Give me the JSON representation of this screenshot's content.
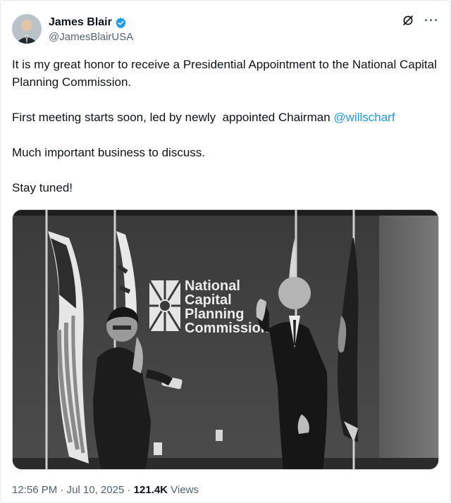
{
  "author": {
    "display_name": "James Blair",
    "handle": "@JamesBlairUSA",
    "verified": true
  },
  "icons": {
    "verified": "verified-badge-icon",
    "grok": "grok-icon",
    "more": "more-options-icon"
  },
  "tweet": {
    "paragraph_1": "It is my great honor to receive a Presidential Appointment to the National Capital Planning Commission.",
    "paragraph_2_text": "First meeting starts soon, led by newly  appointed Chairman ",
    "paragraph_2_mention": "@willscharf",
    "paragraph_3": "Much important business to discuss.",
    "paragraph_4": "Stay tuned!"
  },
  "media": {
    "sign_line_1": "National",
    "sign_line_2": "Capital",
    "sign_line_3": "Planning",
    "sign_line_4": "Commission"
  },
  "meta": {
    "time": "12:56 PM",
    "separator_1": " · ",
    "date": "Jul 10, 2025",
    "separator_2": " · ",
    "views_count": "121.4K",
    "views_label": " Views"
  },
  "colors": {
    "link": "#1d9bf0",
    "verified": "#1d9bf0",
    "secondary_text": "#536471"
  }
}
